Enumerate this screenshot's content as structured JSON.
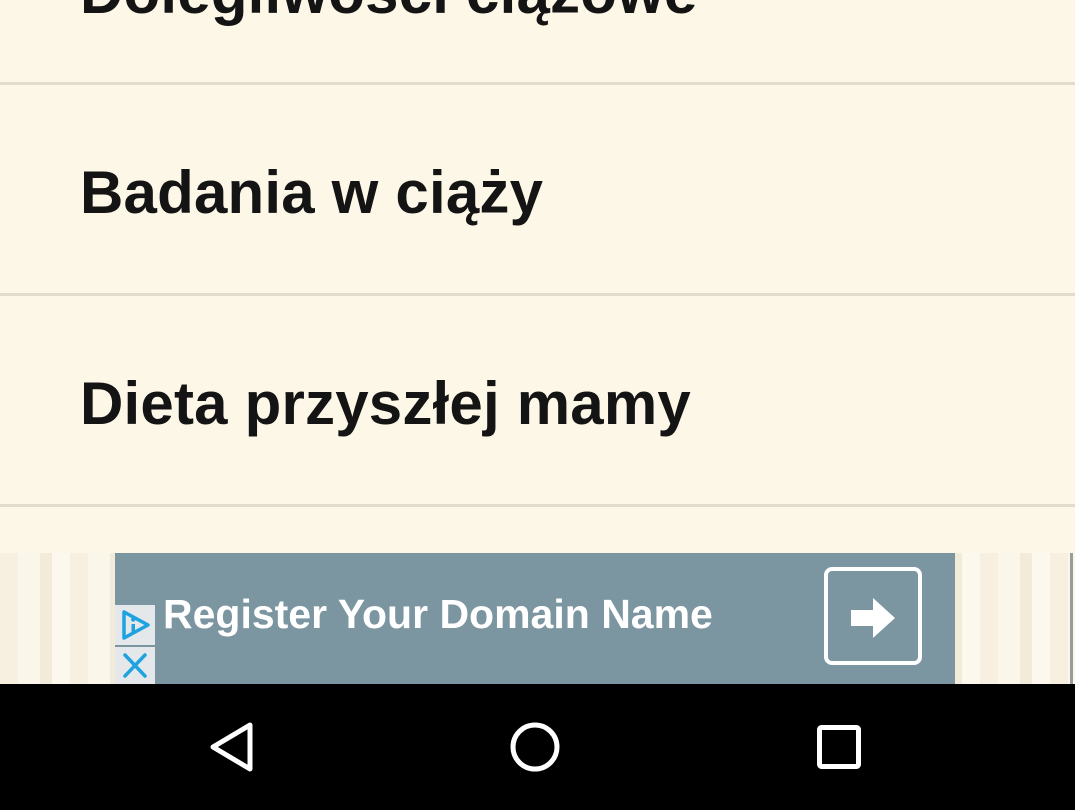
{
  "list": {
    "items": [
      {
        "label": "Dolegliwości ciążowe"
      },
      {
        "label": "Badania w ciąży"
      },
      {
        "label": "Dieta przyszłej mamy"
      }
    ]
  },
  "ad": {
    "title": "Register Your Domain Name",
    "adchoices_icon": "adchoices-icon",
    "close_icon": "close-icon",
    "arrow_icon": "arrow-right-icon",
    "colors": {
      "banner": "#7b95a1",
      "icon_accent": "#1fa3e0"
    }
  },
  "navbar": {
    "back_icon": "back-triangle-icon",
    "home_icon": "home-circle-icon",
    "recents_icon": "recents-square-icon"
  },
  "colors": {
    "background": "#fdf7e8",
    "divider": "#e1dccd",
    "text": "#141414",
    "navbar": "#000000"
  }
}
